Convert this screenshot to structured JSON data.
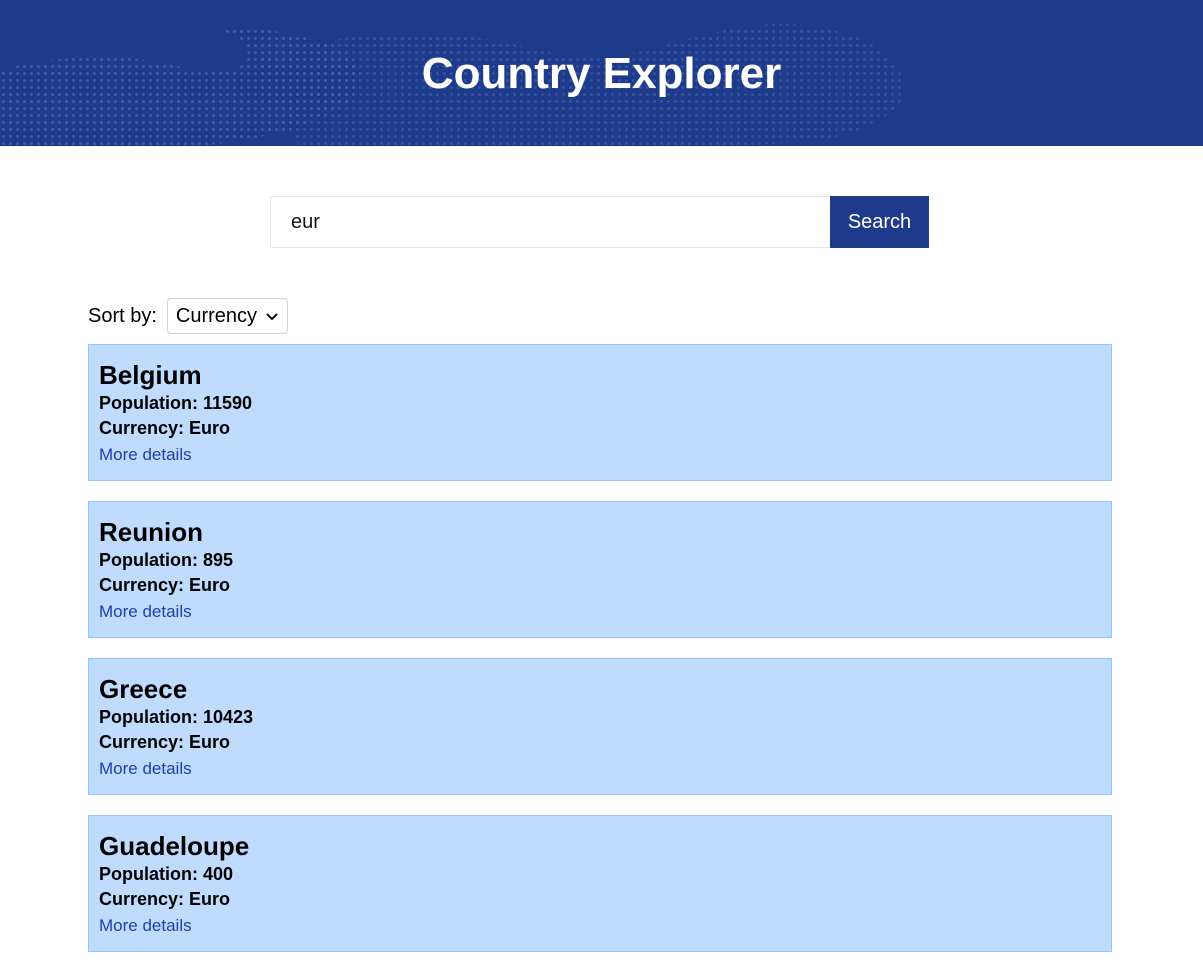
{
  "header": {
    "title": "Country Explorer"
  },
  "search": {
    "value": "eur",
    "button_label": "Search"
  },
  "sort": {
    "label": "Sort by:",
    "selected": "Currency"
  },
  "countries": [
    {
      "name": "Belgium",
      "population_line": "Population: 11590",
      "currency_line": "Currency: Euro",
      "link": "More details"
    },
    {
      "name": "Reunion",
      "population_line": "Population: 895",
      "currency_line": "Currency: Euro",
      "link": "More details"
    },
    {
      "name": "Greece",
      "population_line": "Population: 10423",
      "currency_line": "Currency: Euro",
      "link": "More details"
    },
    {
      "name": "Guadeloupe",
      "population_line": "Population: 400",
      "currency_line": "Currency: Euro",
      "link": "More details"
    }
  ],
  "colors": {
    "primary": "#1e3a8a",
    "card_bg": "#bfdbfe",
    "link": "#1e40af"
  }
}
